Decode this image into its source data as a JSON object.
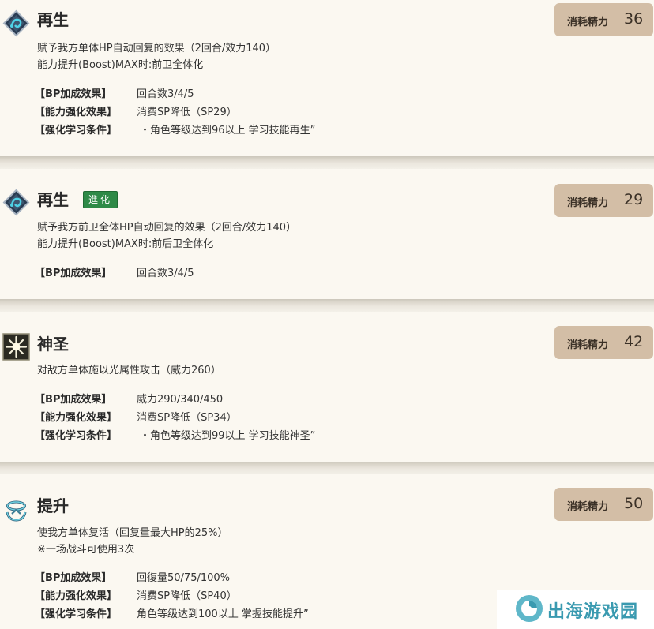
{
  "cost_label": "消耗精力",
  "skills": [
    {
      "name": "再生",
      "badge": "",
      "icon": "diamond-spiral-icon",
      "cost": "36",
      "desc": [
        "赋予我方单体HP自动回复的效果（2回合/效力140）",
        "能力提升(Boost)MAX时:前卫全体化"
      ],
      "rows": [
        {
          "key": "【BP加成效果】",
          "value": "回合数3/4/5"
        },
        {
          "key": "【能力强化效果】",
          "value": "消费SP降低（SP29）"
        },
        {
          "key": "【强化学习条件】",
          "value": "・角色等级达到96以上 学习技能再生”"
        }
      ]
    },
    {
      "name": "再生",
      "badge": "進化",
      "icon": "diamond-spiral-icon",
      "cost": "29",
      "desc": [
        "赋予我方前卫全体HP自动回复的效果（2回合/效力140）",
        "能力提升(Boost)MAX时:前后卫全体化"
      ],
      "rows": [
        {
          "key": "【BP加成效果】",
          "value": "回合数3/4/5"
        }
      ]
    },
    {
      "name": "神圣",
      "badge": "",
      "icon": "holy-light-icon",
      "cost": "42",
      "desc": [
        "对敌方单体施以光属性攻击（威力260）"
      ],
      "rows": [
        {
          "key": "【BP加成效果】",
          "value": "威力290/340/450"
        },
        {
          "key": "【能力强化效果】",
          "value": "消费SP降低（SP34）"
        },
        {
          "key": "【强化学习条件】",
          "value": "・角色等级达到99以上 学习技能神圣”"
        }
      ]
    },
    {
      "name": "提升",
      "badge": "",
      "icon": "raise-halo-icon",
      "cost": "50",
      "desc": [
        "使我方单体复活（回复量最大HP的25%）",
        "※一场战斗可使用3次"
      ],
      "rows": [
        {
          "key": "【BP加成效果】",
          "value": "回復量50/75/100%"
        },
        {
          "key": "【能力强化效果】",
          "value": "消费SP降低（SP40）"
        },
        {
          "key": "【强化学习条件】",
          "value": "角色等级达到100以上 掌握技能提升”"
        }
      ]
    }
  ],
  "watermark": {
    "text": "出海游戏园",
    "icon": "watermark-logo-icon"
  }
}
